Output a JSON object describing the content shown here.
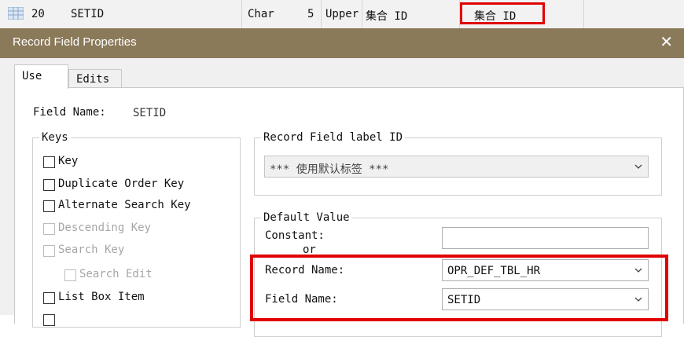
{
  "top_row": {
    "row_number": "20",
    "field_name": "SETID",
    "type": "Char",
    "length": "5",
    "format": "Upper",
    "short_name": "集合 ID",
    "long_name": "集合 ID",
    "highlight_color": "#e00000"
  },
  "dialog": {
    "title": "Record Field Properties",
    "close_glyph": "✕",
    "titlebar_color": "#8b7a5a",
    "tabs": [
      {
        "label": "Use",
        "active": true
      },
      {
        "label": "Edits",
        "active": false
      }
    ],
    "field_name_label": "Field Name:",
    "field_name_value": "SETID",
    "keys": {
      "legend": "Keys",
      "items": [
        {
          "label": "Key",
          "checked": false,
          "enabled": true
        },
        {
          "label": "Duplicate Order Key",
          "checked": false,
          "enabled": true
        },
        {
          "label": "Alternate Search Key",
          "checked": false,
          "enabled": true
        },
        {
          "label": "Descending Key",
          "checked": false,
          "enabled": false
        },
        {
          "label": "Search Key",
          "checked": false,
          "enabled": false
        },
        {
          "label": "Search Edit",
          "checked": false,
          "enabled": false
        },
        {
          "label": "List Box Item",
          "checked": false,
          "enabled": true
        }
      ]
    },
    "label_id": {
      "legend": "Record Field label ID",
      "selected": "*** 使用默认标签 ***"
    },
    "default_value": {
      "legend": "Default Value",
      "constant_label": "Constant:",
      "constant_value": "",
      "or_label": "or",
      "record_name_label": "Record Name:",
      "record_name_value": "OPR_DEF_TBL_HR",
      "field_name_label": "Field Name:",
      "field_name_value": "SETID"
    }
  }
}
